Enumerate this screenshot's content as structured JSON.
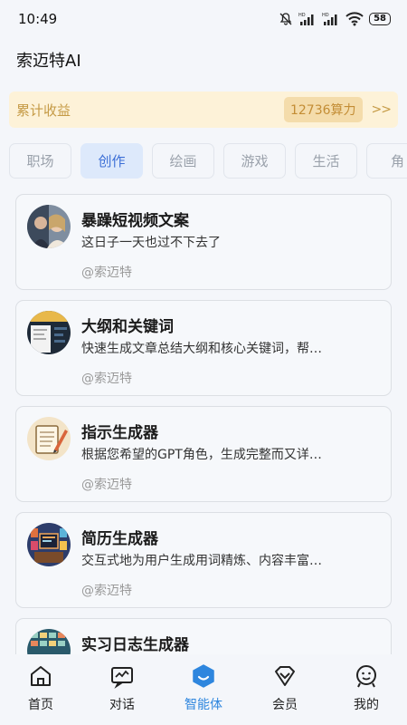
{
  "status": {
    "time": "10:49",
    "battery": "58",
    "hd1": "HD",
    "hd2": "HD"
  },
  "app": {
    "title": "索迈特AI"
  },
  "earnings": {
    "label": "累计收益",
    "value": "12736算力",
    "more": ">>"
  },
  "tabs": [
    {
      "label": "职场"
    },
    {
      "label": "创作"
    },
    {
      "label": "绘画"
    },
    {
      "label": "游戏"
    },
    {
      "label": "生活"
    },
    {
      "label": "角"
    }
  ],
  "active_tab": "创作",
  "cards": [
    {
      "title": "暴躁短视频文案",
      "desc": "这日子一天也过不下去了",
      "author": "@索迈特",
      "avatar": "photo-avatar"
    },
    {
      "title": "大纲和关键词",
      "desc": "快速生成文章总结大纲和核心关键词，帮…",
      "author": "@索迈特",
      "avatar": "document-avatar"
    },
    {
      "title": "指示生成器",
      "desc": "根据您希望的GPT角色，生成完整而又详…",
      "author": "@索迈特",
      "avatar": "notepad-avatar"
    },
    {
      "title": "简历生成器",
      "desc": "交互式地为用户生成用词精炼、内容丰富…",
      "author": "@索迈特",
      "avatar": "desk-avatar"
    },
    {
      "title": "实习日志生成器",
      "desc": "",
      "author": "",
      "avatar": "board-avatar"
    }
  ],
  "nav": [
    {
      "label": "首页",
      "icon": "home-icon"
    },
    {
      "label": "对话",
      "icon": "chat-icon"
    },
    {
      "label": "智能体",
      "icon": "agent-icon"
    },
    {
      "label": "会员",
      "icon": "vip-icon"
    },
    {
      "label": "我的",
      "icon": "profile-icon"
    }
  ],
  "colors": {
    "accent": "#2e86de",
    "tab_active_bg": "#dde9fb",
    "earnings_bg": "#fdf2d8"
  }
}
